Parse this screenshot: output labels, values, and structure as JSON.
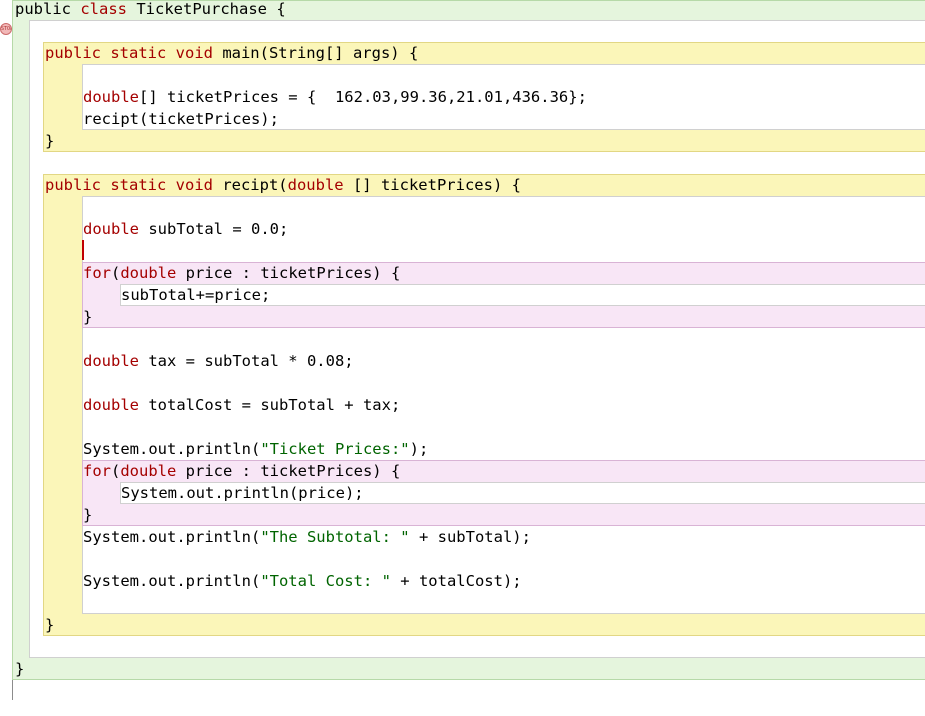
{
  "editor": {
    "language": "java",
    "breakpoint_icon": "stop-icon",
    "lines": [
      {
        "id": "class-header",
        "tokens": [
          {
            "t": "public",
            "k": "plain"
          },
          {
            "t": " ",
            "k": "plain"
          },
          {
            "t": "class",
            "k": "kw"
          },
          {
            "t": " TicketPurchase {",
            "k": "plain"
          }
        ]
      },
      {
        "id": "main-header",
        "tokens": [
          {
            "t": "public static ",
            "k": "kw"
          },
          {
            "t": "void",
            "k": "kw"
          },
          {
            "t": " main(String[] args) {",
            "k": "plain"
          }
        ]
      },
      {
        "id": "prices-decl",
        "tokens": [
          {
            "t": "double",
            "k": "kw"
          },
          {
            "t": "[] ticketPrices = {  162.03,99.36,21.01,436.36};",
            "k": "plain"
          }
        ]
      },
      {
        "id": "recipt-call",
        "tokens": [
          {
            "t": "recipt(ticketPrices);",
            "k": "plain"
          }
        ]
      },
      {
        "id": "main-close",
        "tokens": [
          {
            "t": "}",
            "k": "plain"
          }
        ]
      },
      {
        "id": "recipt-header",
        "tokens": [
          {
            "t": "public static ",
            "k": "kw"
          },
          {
            "t": "void",
            "k": "kw"
          },
          {
            "t": " recipt(",
            "k": "plain"
          },
          {
            "t": "double",
            "k": "kw"
          },
          {
            "t": " [] ticketPrices) {",
            "k": "plain"
          }
        ]
      },
      {
        "id": "subtotal-decl",
        "tokens": [
          {
            "t": "double",
            "k": "kw"
          },
          {
            "t": " subTotal = 0.0;",
            "k": "plain"
          }
        ]
      },
      {
        "id": "for1-header",
        "tokens": [
          {
            "t": "for",
            "k": "kw"
          },
          {
            "t": "(",
            "k": "plain"
          },
          {
            "t": "double",
            "k": "kw"
          },
          {
            "t": " price : ticketPrices) {",
            "k": "plain"
          }
        ]
      },
      {
        "id": "for1-body",
        "tokens": [
          {
            "t": "subTotal+=price;",
            "k": "plain"
          }
        ]
      },
      {
        "id": "for1-close",
        "tokens": [
          {
            "t": "}",
            "k": "plain"
          }
        ]
      },
      {
        "id": "tax-decl",
        "tokens": [
          {
            "t": "double",
            "k": "kw"
          },
          {
            "t": " tax = subTotal * 0.08;",
            "k": "plain"
          }
        ]
      },
      {
        "id": "total-decl",
        "tokens": [
          {
            "t": "double",
            "k": "kw"
          },
          {
            "t": " totalCost = subTotal + tax;",
            "k": "plain"
          }
        ]
      },
      {
        "id": "print-header",
        "tokens": [
          {
            "t": "System.out.println(",
            "k": "plain"
          },
          {
            "t": "\"Ticket Prices:\"",
            "k": "str"
          },
          {
            "t": ");",
            "k": "plain"
          }
        ]
      },
      {
        "id": "for2-header",
        "tokens": [
          {
            "t": "for",
            "k": "kw"
          },
          {
            "t": "(",
            "k": "plain"
          },
          {
            "t": "double",
            "k": "kw"
          },
          {
            "t": " price : ticketPrices) {",
            "k": "plain"
          }
        ]
      },
      {
        "id": "for2-body",
        "tokens": [
          {
            "t": "System.out.println(price);",
            "k": "plain"
          }
        ]
      },
      {
        "id": "for2-close",
        "tokens": [
          {
            "t": "}",
            "k": "plain"
          }
        ]
      },
      {
        "id": "print-subtotal",
        "tokens": [
          {
            "t": "System.out.println(",
            "k": "plain"
          },
          {
            "t": "\"The Subtotal: \"",
            "k": "str"
          },
          {
            "t": " + subTotal);",
            "k": "plain"
          }
        ]
      },
      {
        "id": "print-total",
        "tokens": [
          {
            "t": "System.out.println(",
            "k": "plain"
          },
          {
            "t": "\"Total Cost: \"",
            "k": "str"
          },
          {
            "t": " + totalCost);",
            "k": "plain"
          }
        ]
      },
      {
        "id": "recipt-close",
        "tokens": [
          {
            "t": "}",
            "k": "plain"
          }
        ]
      },
      {
        "id": "class-close",
        "tokens": [
          {
            "t": "}",
            "k": "plain"
          }
        ]
      }
    ]
  }
}
